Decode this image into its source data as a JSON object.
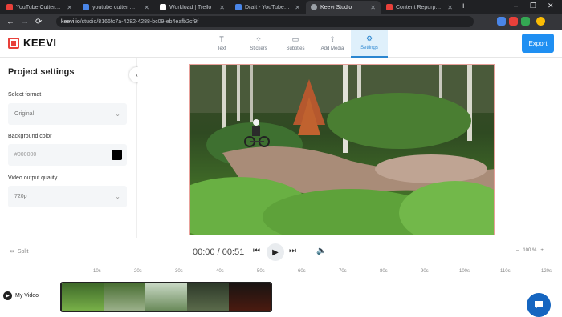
{
  "browser": {
    "tabs": [
      {
        "title": "YouTube Cutter - Land",
        "favicon_color": "#e8403a",
        "active": false
      },
      {
        "title": "youtube cutter Reque",
        "favicon_color": "#4a86e8",
        "active": false
      },
      {
        "title": "Workload | Trello",
        "favicon_color": "#ffffff",
        "active": false
      },
      {
        "title": "Draft - YouTube Cutter",
        "favicon_color": "#4a86e8",
        "active": false
      },
      {
        "title": "Keevi Studio",
        "favicon_color": "#9aa0a6",
        "active": true
      },
      {
        "title": "Content Repurposing",
        "favicon_color": "#e8403a",
        "active": false
      }
    ],
    "new_tab": "+",
    "window_controls": [
      "–",
      "❐",
      "✕"
    ],
    "url_host": "keevi.io",
    "url_path": "/studio/8166fc7a-4282-4288-bc09-eb4eafb2cf9f",
    "nav": {
      "back": "←",
      "forward": "→",
      "reload": "⟳"
    }
  },
  "app": {
    "logo_text": "KEEVI",
    "tools": [
      {
        "label": "Text",
        "icon": "T"
      },
      {
        "label": "Stickers",
        "icon": "⁘"
      },
      {
        "label": "Subtitles",
        "icon": "▭"
      },
      {
        "label": "Add Media",
        "icon": "⇪"
      },
      {
        "label": "Settings",
        "icon": "⚙"
      }
    ],
    "export_label": "Export",
    "accent_color": "#1f8ff2"
  },
  "sidebar": {
    "title": "Project settings",
    "format_label": "Select format",
    "format_value": "Original",
    "bg_label": "Background color",
    "bg_placeholder": "#000000",
    "bg_swatch": "#000000",
    "quality_label": "Video output quality",
    "quality_value": "720p",
    "collapse_icon": "‹"
  },
  "player": {
    "split_label": "Split",
    "time": "00:00 / 00:51",
    "prev_icon": "⏮",
    "play_icon": "▶",
    "next_icon": "⏭",
    "volume_icon": "🔈",
    "zoom_minus": "–",
    "zoom_value": "100 %",
    "zoom_plus": "+"
  },
  "timeline": {
    "ticks": [
      "10s",
      "20s",
      "30s",
      "40s",
      "50s",
      "60s",
      "70s",
      "80s",
      "90s",
      "100s",
      "110s",
      "120s"
    ],
    "track_label": "My Video"
  }
}
